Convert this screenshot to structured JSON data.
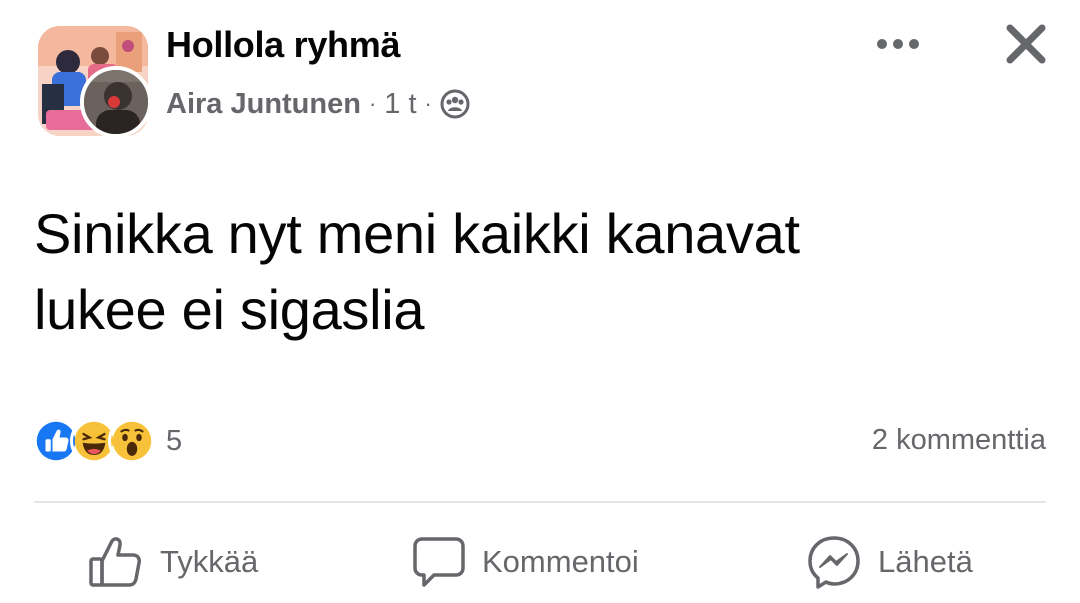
{
  "post": {
    "group_name": "Hollola ryhmä",
    "author": "Aira Juntunen",
    "time": "1 t",
    "separator": "·",
    "privacy_icon": "group-members-icon",
    "text_line1": "Sinikka nyt meni kaikki kanavat",
    "text_line2": "lukee ei sigaslia"
  },
  "header_actions": {
    "more_icon": "more-dots-icon",
    "close_icon": "close-icon"
  },
  "reactions": {
    "types": [
      "like",
      "haha",
      "wow"
    ],
    "count": "5",
    "comments_label": "2 kommenttia"
  },
  "actions": {
    "like_label": "Tykkää",
    "comment_label": "Kommentoi",
    "share_label": "Lähetä"
  },
  "colors": {
    "text": "#050505",
    "secondary": "#65676b",
    "like_blue": "#1877f2",
    "emoji_yellow": "#f7c23a",
    "divider": "#e4e6eb"
  }
}
